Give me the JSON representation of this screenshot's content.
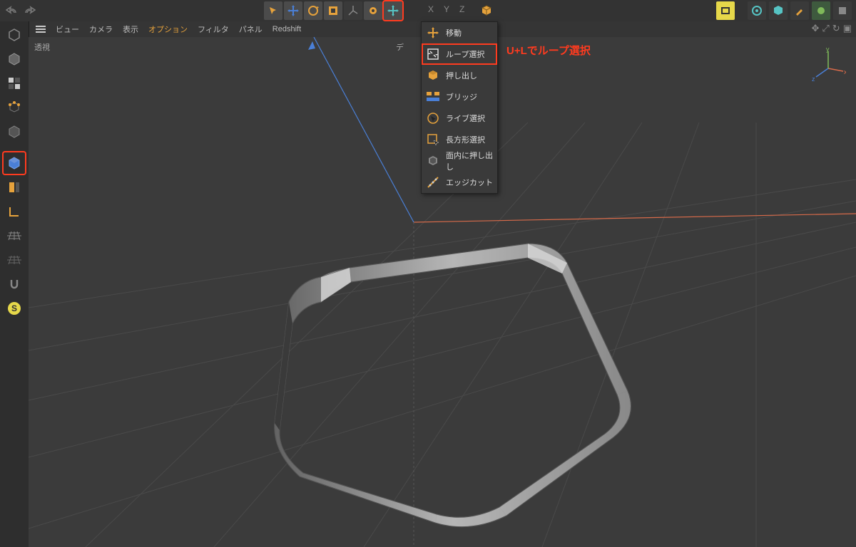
{
  "viewport": {
    "label_left": "透視",
    "label_mid": "デ"
  },
  "menubar": [
    "ビュー",
    "カメラ",
    "表示",
    "オプション",
    "フィルタ",
    "パネル",
    "Redshift"
  ],
  "menubar_active_index": 3,
  "axis_labels": [
    "X",
    "Y",
    "Z"
  ],
  "dropdown": [
    {
      "icon": "move",
      "label": "移動"
    },
    {
      "icon": "loop",
      "label": "ループ選択",
      "selected": true
    },
    {
      "icon": "extrude",
      "label": "押し出し"
    },
    {
      "icon": "bridge",
      "label": "ブリッジ"
    },
    {
      "icon": "live",
      "label": "ライブ選択"
    },
    {
      "icon": "rect",
      "label": "長方形選択"
    },
    {
      "icon": "inner",
      "label": "面内に押し出し"
    },
    {
      "icon": "edgecut",
      "label": "エッジカット"
    }
  ],
  "annotation": "U+Lでループ選択",
  "axis_widget": {
    "x": "x",
    "y": "y",
    "z": "z"
  },
  "colors": {
    "accent": "#e6a23c",
    "highlight": "#ff3b1f",
    "blue": "#4a7fd6",
    "red": "#d96b4a",
    "green": "#7fba5a",
    "cyan": "#56c4c4",
    "magenta": "#c45bb3"
  }
}
